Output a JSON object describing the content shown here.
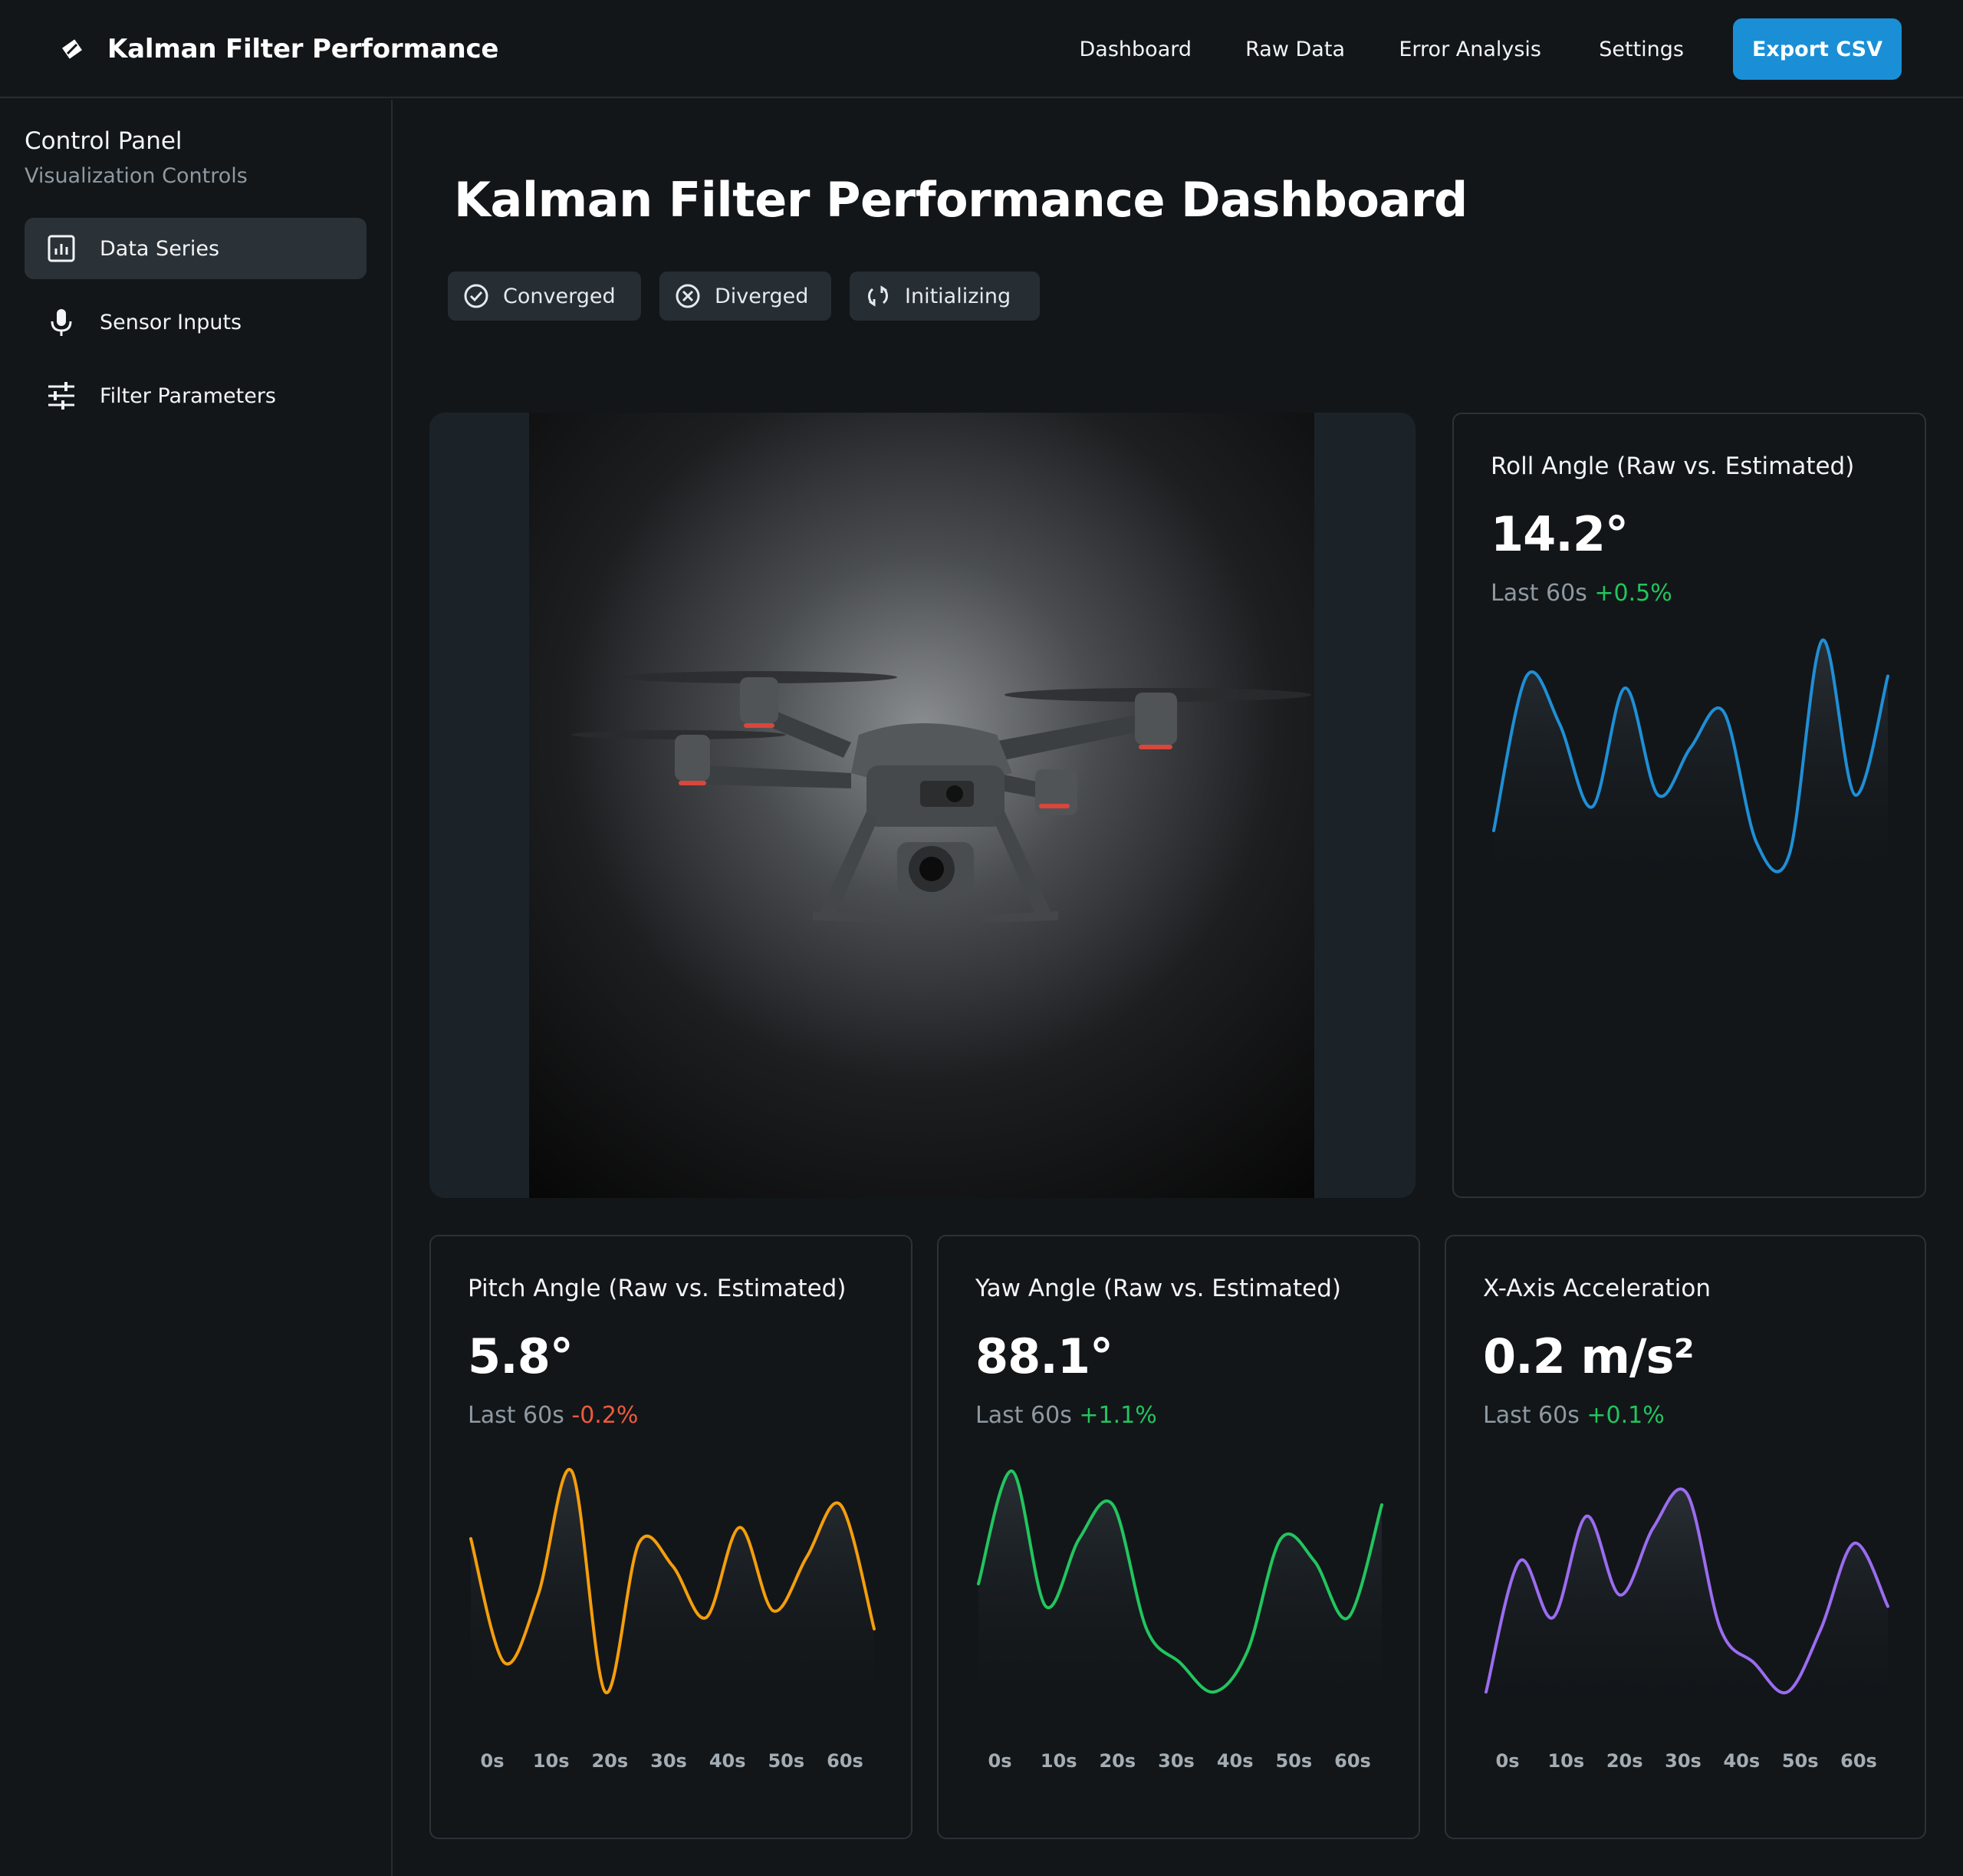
{
  "header": {
    "title": "Kalman Filter Performance",
    "nav": [
      "Dashboard",
      "Raw Data",
      "Error Analysis",
      "Settings"
    ],
    "export_label": "Export CSV",
    "accent": "#1a8fd6"
  },
  "sidebar": {
    "title": "Control Panel",
    "subtitle": "Visualization Controls",
    "items": [
      {
        "label": "Data Series",
        "icon": "bar-chart-icon",
        "active": true
      },
      {
        "label": "Sensor Inputs",
        "icon": "microphone-icon",
        "active": false
      },
      {
        "label": "Filter Parameters",
        "icon": "sliders-icon",
        "active": false
      }
    ]
  },
  "main": {
    "title": "Kalman Filter Performance Dashboard",
    "chips": [
      {
        "label": "Converged",
        "icon": "check-circle-icon"
      },
      {
        "label": "Diverged",
        "icon": "x-circle-icon"
      },
      {
        "label": "Initializing",
        "icon": "refresh-icon"
      }
    ],
    "hero_image": "drone-photo"
  },
  "cards": [
    {
      "title": "Roll Angle (Raw vs. Estimated)",
      "value": "14.2°",
      "period": "Last 60s",
      "change": "+0.5%",
      "trend": "up",
      "color": "#1f8fd6",
      "show_ticks": false
    },
    {
      "title": "Pitch Angle (Raw vs. Estimated)",
      "value": "5.8°",
      "period": "Last 60s",
      "change": "-0.2%",
      "trend": "down",
      "color": "#f59e0b",
      "show_ticks": true
    },
    {
      "title": "Yaw Angle (Raw vs. Estimated)",
      "value": "88.1°",
      "period": "Last 60s",
      "change": "+1.1%",
      "trend": "up",
      "color": "#22c55e",
      "show_ticks": true
    },
    {
      "title": "X-Axis Acceleration",
      "value": "0.2 m/s²",
      "period": "Last 60s",
      "change": "+0.1%",
      "trend": "up",
      "color": "#9b6cf0",
      "show_ticks": true
    }
  ],
  "chart_data": [
    {
      "type": "area",
      "x": [
        0,
        5,
        10,
        15,
        20,
        25,
        30,
        35,
        40,
        45,
        50,
        55,
        60
      ],
      "series": [
        {
          "values": [
            0.2,
            0.85,
            0.65,
            0.3,
            0.8,
            0.35,
            0.55,
            0.7,
            0.15,
            0.1,
            1.0,
            0.35,
            0.85
          ]
        }
      ]
    },
    {
      "type": "area",
      "x": [
        0,
        5,
        10,
        15,
        20,
        25,
        30,
        35,
        40,
        45,
        50,
        55,
        60
      ],
      "categories": [
        "0s",
        "10s",
        "20s",
        "30s",
        "40s",
        "50s",
        "60s"
      ],
      "series": [
        {
          "values": [
            0.7,
            0.15,
            0.45,
            1.0,
            0.02,
            0.68,
            0.58,
            0.35,
            0.75,
            0.38,
            0.62,
            0.85,
            0.3
          ]
        }
      ]
    },
    {
      "type": "area",
      "x": [
        0,
        5,
        10,
        15,
        20,
        25,
        30,
        35,
        40,
        45,
        50,
        55,
        60
      ],
      "categories": [
        "0s",
        "10s",
        "20s",
        "30s",
        "40s",
        "50s",
        "60s"
      ],
      "series": [
        {
          "values": [
            0.5,
            1.0,
            0.4,
            0.7,
            0.85,
            0.3,
            0.15,
            0.02,
            0.2,
            0.7,
            0.6,
            0.35,
            0.85
          ]
        }
      ]
    },
    {
      "type": "area",
      "x": [
        0,
        5,
        10,
        15,
        20,
        25,
        30,
        35,
        40,
        45,
        50,
        55,
        60
      ],
      "categories": [
        "0s",
        "10s",
        "20s",
        "30s",
        "40s",
        "50s",
        "60s"
      ],
      "series": [
        {
          "values": [
            0.02,
            0.6,
            0.35,
            0.8,
            0.45,
            0.75,
            0.9,
            0.3,
            0.15,
            0.02,
            0.3,
            0.68,
            0.4
          ]
        }
      ]
    }
  ]
}
